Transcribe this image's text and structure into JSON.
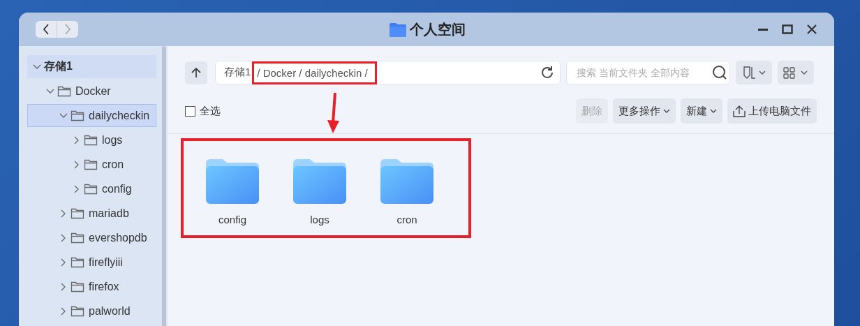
{
  "window": {
    "title": "个人空间"
  },
  "sidebar": {
    "tree": [
      {
        "label": "存储1",
        "expanded": true,
        "selected": false,
        "root": true,
        "children": [
          {
            "label": "Docker",
            "expanded": true,
            "selected": false,
            "children": [
              {
                "label": "dailycheckin",
                "expanded": true,
                "selected": true,
                "children": [
                  {
                    "label": "logs",
                    "expanded": false,
                    "selected": false
                  },
                  {
                    "label": "cron",
                    "expanded": false,
                    "selected": false
                  },
                  {
                    "label": "config",
                    "expanded": false,
                    "selected": false
                  }
                ]
              },
              {
                "label": "mariadb",
                "expanded": false,
                "selected": false
              },
              {
                "label": "evershopdb",
                "expanded": false,
                "selected": false
              },
              {
                "label": "fireflyiii",
                "expanded": false,
                "selected": false
              },
              {
                "label": "firefox",
                "expanded": false,
                "selected": false
              },
              {
                "label": "palworld",
                "expanded": false,
                "selected": false
              }
            ]
          }
        ]
      }
    ]
  },
  "path": [
    {
      "text": "存储1",
      "highlighted": false
    },
    {
      "text": "/ Docker / dailycheckin /",
      "highlighted": true
    }
  ],
  "search": {
    "placeholder": "搜索 当前文件夹 全部内容"
  },
  "select_all": {
    "label": "全选",
    "checked": false
  },
  "actions": [
    {
      "label": "删除",
      "disabled": true,
      "kind": "plain"
    },
    {
      "label": "更多操作",
      "disabled": false,
      "kind": "menu"
    },
    {
      "label": "新建",
      "disabled": false,
      "kind": "menu"
    },
    {
      "label": "上传电脑文件",
      "disabled": false,
      "kind": "upload"
    }
  ],
  "files": {
    "highlighted": true,
    "callout_arrow": true,
    "items": [
      {
        "name": "config"
      },
      {
        "name": "logs"
      },
      {
        "name": "cron"
      }
    ]
  }
}
